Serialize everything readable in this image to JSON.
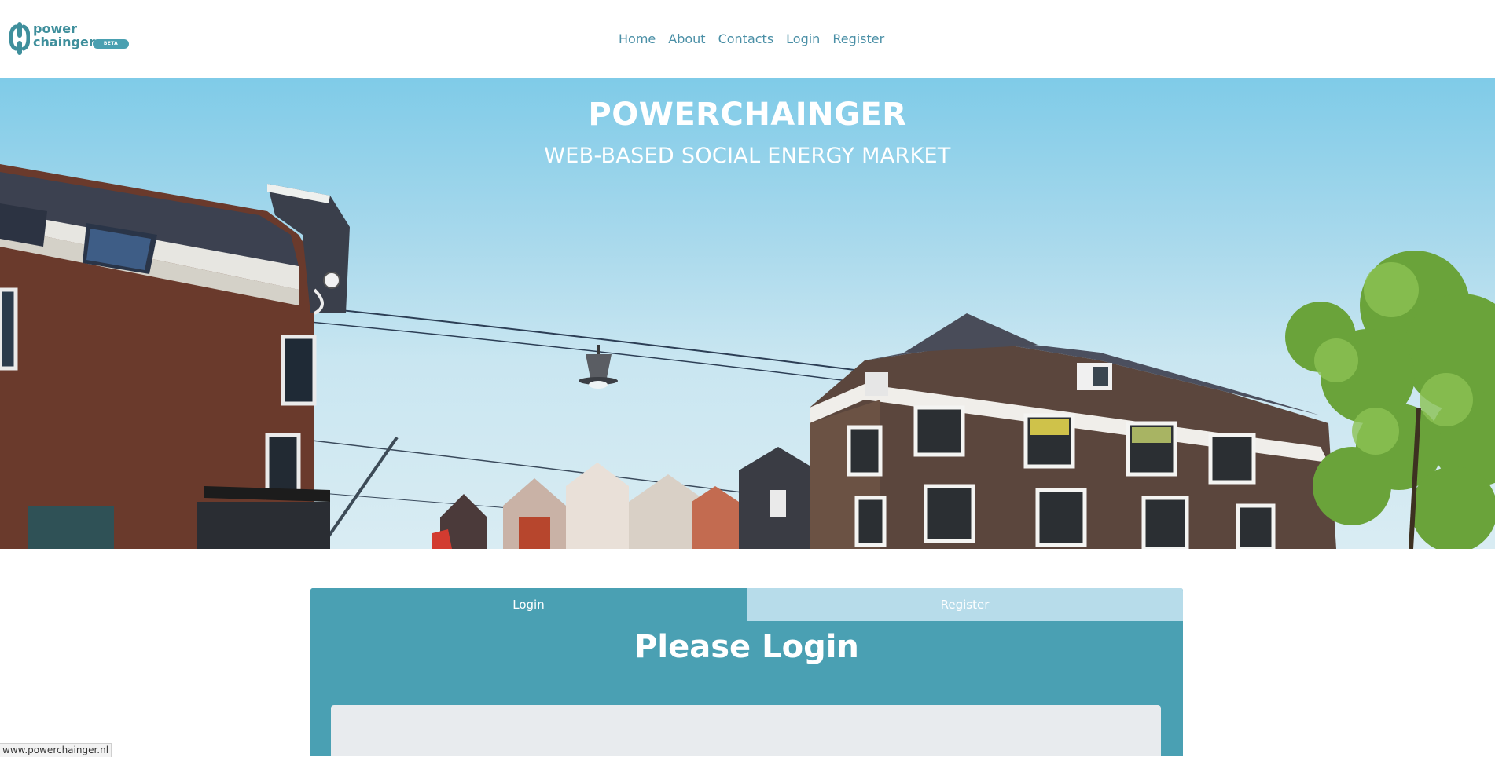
{
  "header": {
    "logo": {
      "line1": "power",
      "line2": "chainger",
      "badge": "BETA"
    },
    "nav": [
      {
        "label": "Home"
      },
      {
        "label": "About"
      },
      {
        "label": "Contacts"
      },
      {
        "label": "Login"
      },
      {
        "label": "Register"
      }
    ]
  },
  "hero": {
    "title": "POWERCHAINGER",
    "subtitle": "WEB-BASED SOCIAL ENERGY MARKET"
  },
  "auth": {
    "tabs": {
      "login": "Login",
      "register": "Register",
      "active": "login"
    },
    "heading": "Please Login"
  },
  "statusbar": {
    "url": "www.powerchainger.nl"
  },
  "colors": {
    "brand": "#4aa0b3",
    "nav_text": "#4a8fa6",
    "tab_inactive": "#b7dcea",
    "form_bg": "#e8ebee"
  }
}
